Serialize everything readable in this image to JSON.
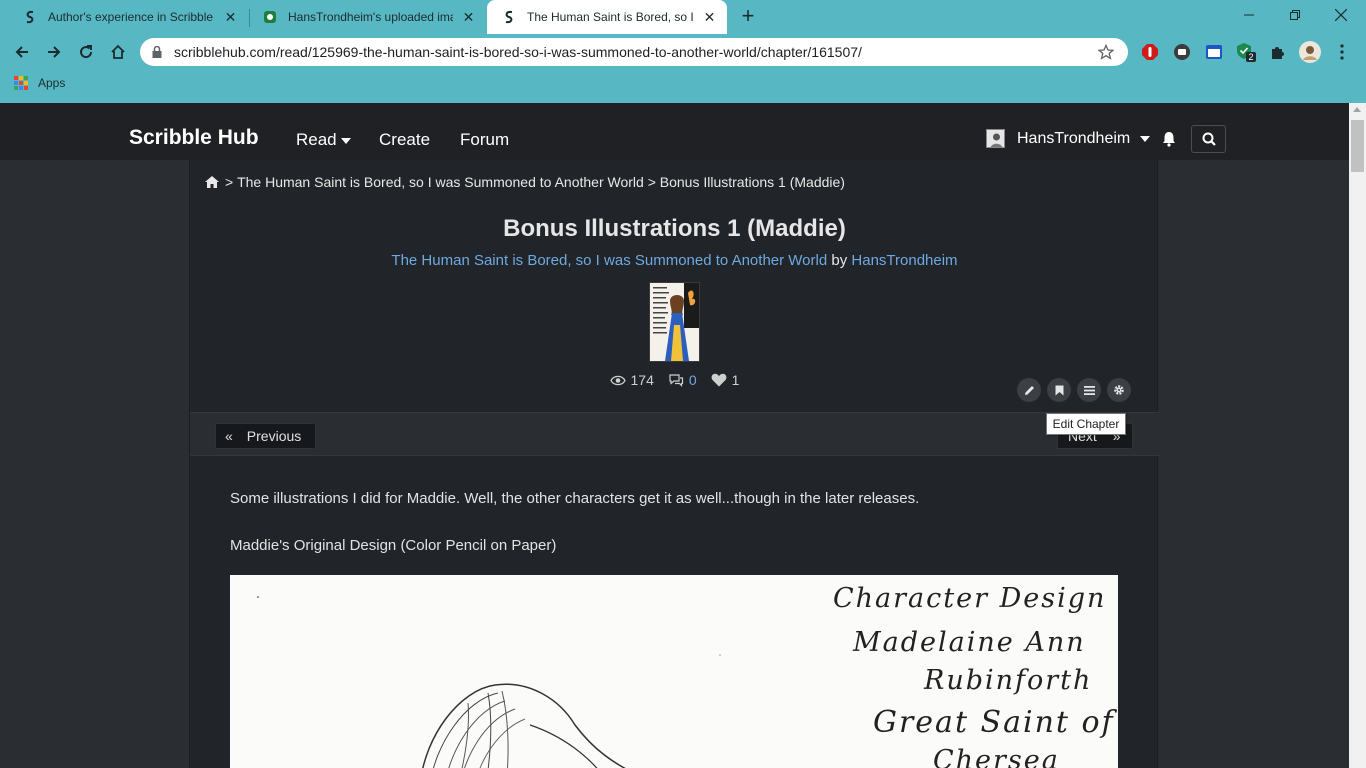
{
  "browser": {
    "tabs": [
      {
        "title": "Author's experience in Scribble H",
        "active": false
      },
      {
        "title": "HansTrondheim's uploaded imag",
        "active": false
      },
      {
        "title": "The Human Saint is Bored, so I w",
        "active": true
      }
    ],
    "url": "scribblehub.com/read/125969-the-human-saint-is-bored-so-i-was-summoned-to-another-world/chapter/161507/",
    "bookmarks": {
      "apps_label": "Apps"
    },
    "extension_badge": "2"
  },
  "site": {
    "brand": "Scribble Hub",
    "nav": {
      "read": "Read",
      "create": "Create",
      "forum": "Forum"
    },
    "username": "HansTrondheim"
  },
  "chapter": {
    "breadcrumb": {
      "separator": ">",
      "series": "The Human Saint is Bored, so I was Summoned to Another World",
      "chapter": "Bonus Illustrations 1 (Maddie)"
    },
    "title": "Bonus Illustrations 1 (Maddie)",
    "series_title": "The Human Saint is Bored, so I was Summoned to Another World",
    "by": "by",
    "author": "HansTrondheim",
    "stats": {
      "views": "174",
      "comments": "0",
      "favorites": "1"
    },
    "tooltip": "Edit Chapter",
    "pager": {
      "prev_symbol": "«",
      "prev": "Previous",
      "next": "Next",
      "next_symbol": "»"
    },
    "paragraphs": [
      "Some illustrations I did for Maddie.  Well, the other characters get it as well...though in the later releases.",
      "Maddie's Original Design (Color Pencil on Paper)"
    ],
    "illustration_text": [
      "Character Design",
      "Madelaine Ann",
      "Rubinforth",
      "Great Saint of",
      "Chersea"
    ]
  },
  "colors": {
    "chrome": "#57b8c3",
    "link": "#6ea9e0",
    "navbar": "#1f2124",
    "content": "#212428"
  }
}
